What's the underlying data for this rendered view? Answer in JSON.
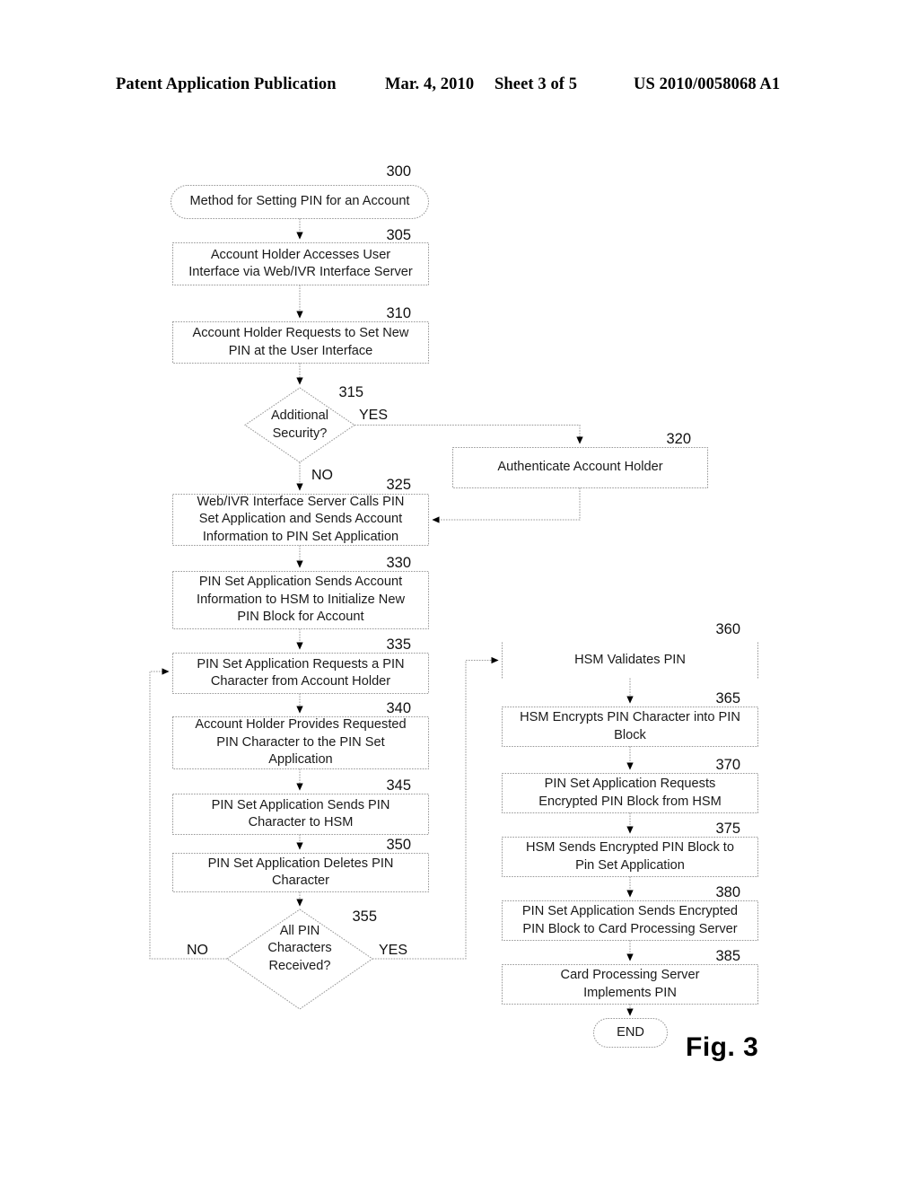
{
  "header": {
    "publication": "Patent Application Publication",
    "date": "Mar. 4, 2010",
    "sheet": "Sheet 3 of 5",
    "number": "US 2010/0058068 A1"
  },
  "figure": {
    "caption": "Fig. 3"
  },
  "diagram": {
    "type": "flowchart",
    "title": "Method for Setting PIN for an Account",
    "nodes": [
      {
        "id": "300",
        "ref": "300",
        "shape": "terminator",
        "text": "Method for Setting PIN for an Account"
      },
      {
        "id": "305",
        "ref": "305",
        "shape": "process",
        "text": "Account Holder Accesses User\nInterface via Web/IVR Interface Server"
      },
      {
        "id": "310",
        "ref": "310",
        "shape": "process",
        "text": "Account Holder Requests to Set New\nPIN at the User Interface"
      },
      {
        "id": "315",
        "ref": "315",
        "shape": "decision",
        "text": "Additional\nSecurity?"
      },
      {
        "id": "320",
        "ref": "320",
        "shape": "process",
        "text": "Authenticate Account Holder"
      },
      {
        "id": "325",
        "ref": "325",
        "shape": "process",
        "text": "Web/IVR Interface Server Calls PIN\nSet Application and Sends Account\nInformation to PIN Set Application"
      },
      {
        "id": "330",
        "ref": "330",
        "shape": "process",
        "text": "PIN Set Application Sends Account\nInformation to HSM to Initialize New\nPIN Block for Account"
      },
      {
        "id": "335",
        "ref": "335",
        "shape": "process",
        "text": "PIN Set Application Requests a PIN\nCharacter from Account Holder"
      },
      {
        "id": "340",
        "ref": "340",
        "shape": "process",
        "text": "Account Holder Provides Requested\nPIN Character to the PIN Set\nApplication"
      },
      {
        "id": "345",
        "ref": "345",
        "shape": "process",
        "text": "PIN Set Application Sends PIN\nCharacter to HSM"
      },
      {
        "id": "350",
        "ref": "350",
        "shape": "process",
        "text": "PIN Set Application Deletes PIN\nCharacter"
      },
      {
        "id": "355",
        "ref": "355",
        "shape": "decision",
        "text": "All PIN\nCharacters\nReceived?"
      },
      {
        "id": "360",
        "ref": "360",
        "shape": "process",
        "text": "HSM Validates PIN"
      },
      {
        "id": "365",
        "ref": "365",
        "shape": "process",
        "text": "HSM Encrypts PIN Character into PIN\nBlock"
      },
      {
        "id": "370",
        "ref": "370",
        "shape": "process",
        "text": "PIN Set Application Requests\nEncrypted PIN Block from HSM"
      },
      {
        "id": "375",
        "ref": "375",
        "shape": "process",
        "text": "HSM Sends Encrypted PIN Block to\nPin Set Application"
      },
      {
        "id": "380",
        "ref": "380",
        "shape": "process",
        "text": "PIN Set Application Sends Encrypted\nPIN Block to Card Processing Server"
      },
      {
        "id": "385",
        "ref": "385",
        "shape": "process",
        "text": "Card Processing Server\nImplements PIN"
      },
      {
        "id": "end",
        "ref": "",
        "shape": "terminator",
        "text": "END"
      }
    ],
    "edge_labels": {
      "d315_yes": "YES",
      "d315_no": "NO",
      "d355_yes": "YES",
      "d355_no": "NO"
    },
    "colors": {
      "stroke": "#808080",
      "arrow": "#000000",
      "text": "#1a1a1a"
    }
  }
}
